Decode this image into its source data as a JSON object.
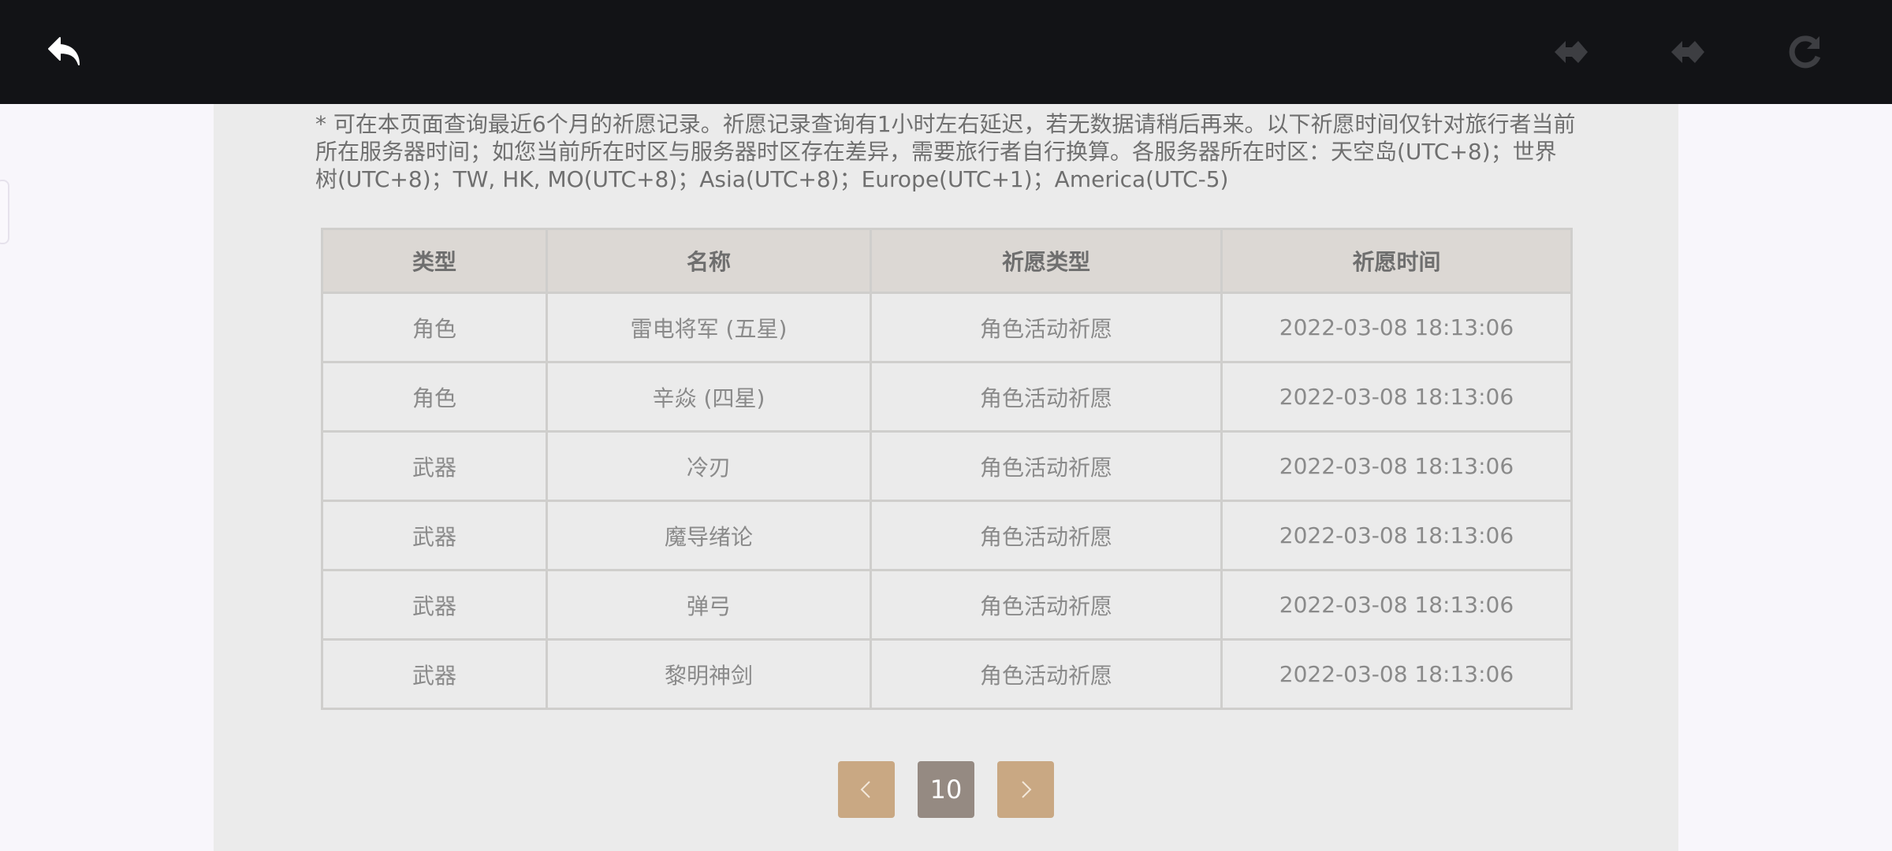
{
  "notice": "* 可在本页面查询最近6个月的祈愿记录。祈愿记录查询有1小时左右延迟，若无数据请稍后再来。以下祈愿时间仅针对旅行者当前所在服务器时间；如您当前所在时区与服务器时区存在差异，需要旅行者自行换算。各服务器所在时区：天空岛(UTC+8)；世界树(UTC+8)；TW, HK, MO(UTC+8)；Asia(UTC+8)；Europe(UTC+1)；America(UTC-5)",
  "table": {
    "headers": [
      "类型",
      "名称",
      "祈愿类型",
      "祈愿时间"
    ],
    "rows": [
      {
        "type": "角色",
        "name": "雷电将军 (五星)",
        "wish_type": "角色活动祈愿",
        "time": "2022-03-08 18:13:06"
      },
      {
        "type": "角色",
        "name": "辛焱 (四星)",
        "wish_type": "角色活动祈愿",
        "time": "2022-03-08 18:13:06"
      },
      {
        "type": "武器",
        "name": "冷刃",
        "wish_type": "角色活动祈愿",
        "time": "2022-03-08 18:13:06"
      },
      {
        "type": "武器",
        "name": "魔导绪论",
        "wish_type": "角色活动祈愿",
        "time": "2022-03-08 18:13:06"
      },
      {
        "type": "武器",
        "name": "弹弓",
        "wish_type": "角色活动祈愿",
        "time": "2022-03-08 18:13:06"
      },
      {
        "type": "武器",
        "name": "黎明神剑",
        "wish_type": "角色活动祈愿",
        "time": "2022-03-08 18:13:06"
      }
    ]
  },
  "pagination": {
    "current_page": "10"
  },
  "colors": {
    "topbar": "#121316",
    "five_star": "#b8733c",
    "four_star": "#a05ccc",
    "pager_button": "#c9a883",
    "pager_current": "#958a82"
  },
  "icons": {
    "back": "back-arrow-icon",
    "forward1": "forward-icon",
    "forward2": "forward-icon",
    "reload": "reload-icon",
    "prev": "chevron-left-icon",
    "next": "chevron-right-icon"
  }
}
